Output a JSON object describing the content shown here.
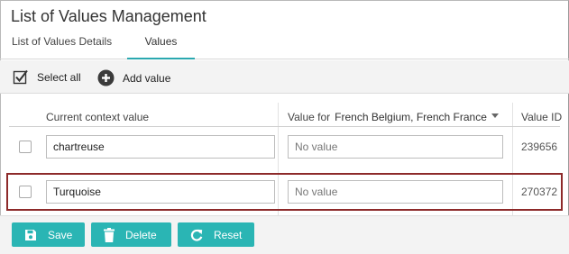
{
  "page": {
    "title": "List of Values Management"
  },
  "tabs": [
    {
      "label": "List of Values Details",
      "active": false
    },
    {
      "label": "Values",
      "active": true
    }
  ],
  "toolbar": {
    "select_all": "Select all",
    "add_value": "Add value"
  },
  "table": {
    "headers": {
      "current_context": "Current context value",
      "value_for": "Value for",
      "value_for_langs": "French Belgium, French France",
      "value_id": "Value ID"
    },
    "rows": [
      {
        "context_value": "chartreuse",
        "value_placeholder": "No value",
        "value_id": "239656",
        "checked": false
      },
      {
        "context_value": "Turquoise",
        "value_placeholder": "No value",
        "value_id": "270372",
        "checked": false,
        "highlighted": true
      }
    ]
  },
  "actions": {
    "save": "Save",
    "delete": "Delete",
    "reset": "Reset"
  },
  "colors": {
    "accent": "#2ab5b4",
    "tab_underline": "#2ba8b0",
    "highlight_border": "#8d2a2a"
  }
}
